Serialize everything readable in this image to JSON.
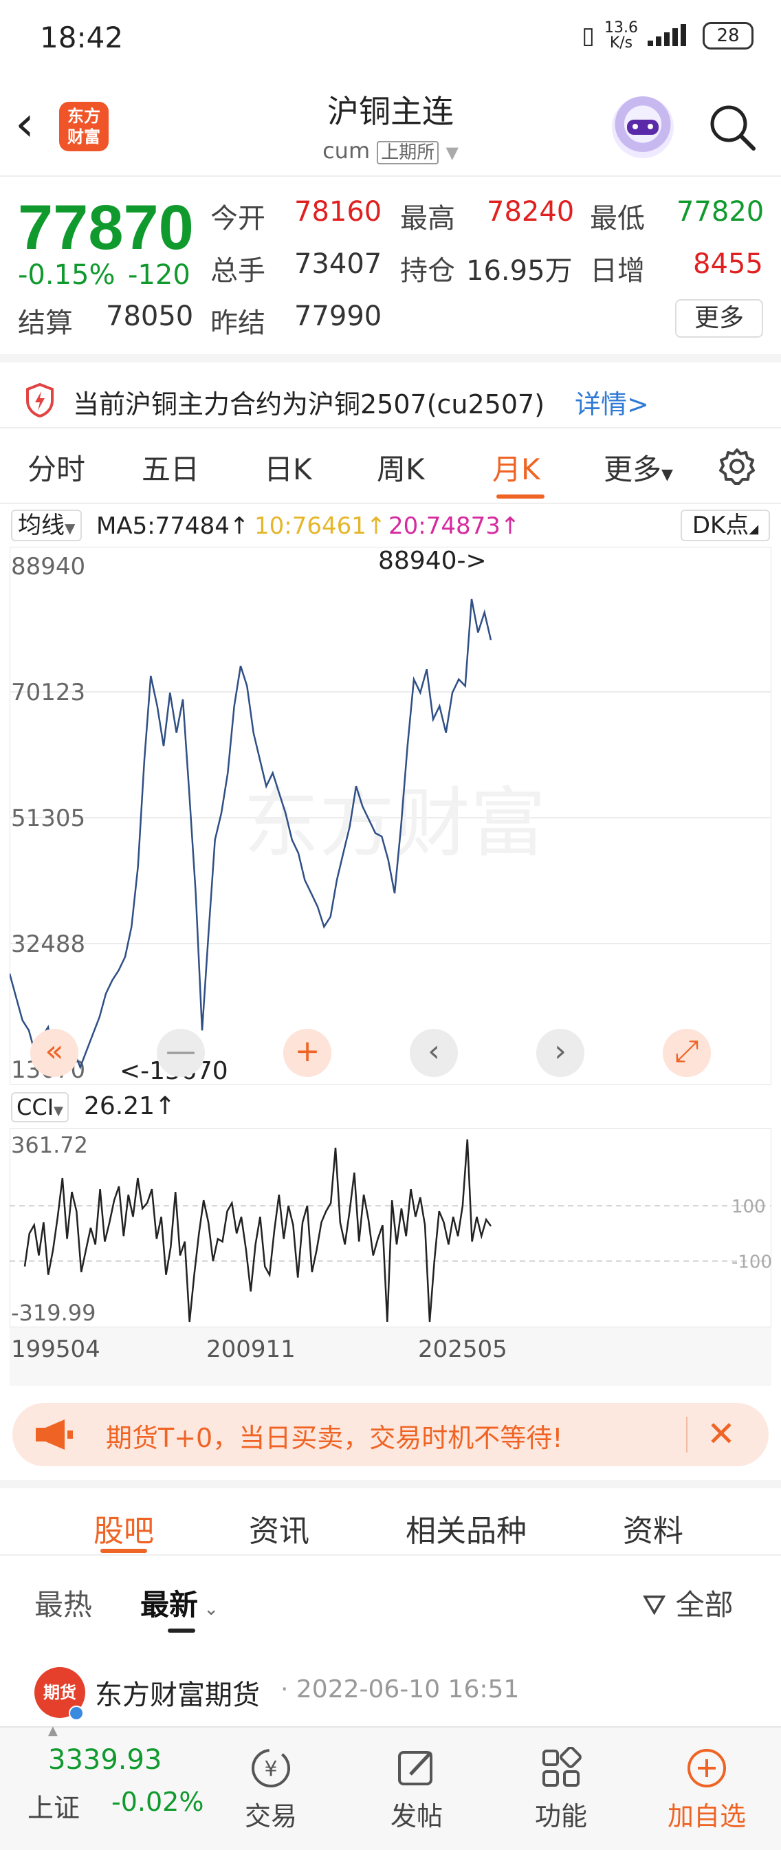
{
  "status_bar": {
    "time": "18:42",
    "net_speed_top": "13.6",
    "net_speed_bottom": "K/s",
    "battery": "28"
  },
  "header": {
    "title": "沪铜主连",
    "code": "cum",
    "exchange": "上期所",
    "logo_line1": "东方",
    "logo_line2": "财富"
  },
  "quote": {
    "last": "77870",
    "pct": "-0.15%",
    "chg": "-120",
    "open_label": "今开",
    "open": "78160",
    "high_label": "最高",
    "high": "78240",
    "low_label": "最低",
    "low": "77820",
    "volume_label": "总手",
    "volume": "73407",
    "oi_label": "持仓",
    "oi": "16.95万",
    "daily_inc_label": "日增",
    "daily_inc": "8455",
    "settle_label": "结算",
    "settle": "78050",
    "prev_settle_label": "昨结",
    "prev_settle": "77990",
    "more": "更多"
  },
  "notice": {
    "text": "当前沪铜主力合约为沪铜2507(cu2507)",
    "link": "详情>"
  },
  "period_tabs": [
    "分时",
    "五日",
    "日K",
    "周K",
    "月K",
    "更多"
  ],
  "active_period": "月K",
  "ma": {
    "select": "均线",
    "ma5": "MA5:77484↑",
    "ma10": "10:76461↑",
    "ma20": "20:74873↑",
    "dk": "DK点"
  },
  "chart_data": [
    {
      "type": "line",
      "title": "",
      "y_ticks": [
        "88940",
        "70123",
        "51305",
        "32488",
        "13670"
      ],
      "ylim": [
        13670,
        88940
      ],
      "max_label": "88940->",
      "min_label": "<-13670",
      "series": [
        {
          "values": [
            28000,
            24500,
            21000,
            19500,
            16000,
            18500,
            20000,
            15000,
            17000,
            14500,
            16500,
            14000,
            16500,
            19000,
            21500,
            25000,
            27000,
            28500,
            30500,
            35000,
            44000,
            60000,
            72500,
            68000,
            62000,
            70000,
            64000,
            69000,
            55000,
            40000,
            19500,
            34000,
            48000,
            52000,
            58000,
            68000,
            74000,
            71000,
            64000,
            60000,
            56000,
            58000,
            55000,
            52000,
            48000,
            46000,
            42000,
            40000,
            38000,
            35000,
            36500,
            42000,
            46000,
            50000,
            56000,
            53000,
            51000,
            49000,
            48500,
            45000,
            40000,
            50000,
            62000,
            72000,
            70000,
            73500,
            66000,
            68000,
            64000,
            70000,
            72000,
            71000,
            84000,
            79000,
            82000,
            77870
          ]
        }
      ]
    },
    {
      "type": "line",
      "title": "",
      "y_ticks": [
        "361.72",
        "-319.99"
      ],
      "ref_lines": [
        "100",
        "-100"
      ],
      "indicator": "CCI",
      "value": "26.21↑",
      "x_ticks": [
        "199504",
        "200911",
        "202505"
      ],
      "series": [
        {
          "values": [
            -120,
            0,
            30,
            -80,
            40,
            -150,
            -60,
            60,
            200,
            -20,
            150,
            80,
            -140,
            -60,
            20,
            -40,
            160,
            -30,
            40,
            120,
            170,
            -10,
            140,
            60,
            200,
            90,
            110,
            160,
            -20,
            60,
            -150,
            -50,
            150,
            -80,
            -30,
            -320,
            -150,
            0,
            120,
            40,
            -100,
            -20,
            -30,
            80,
            110,
            0,
            60,
            -60,
            -210,
            -40,
            60,
            -120,
            -150,
            10,
            140,
            -20,
            100,
            30,
            -160,
            40,
            100,
            -140,
            -60,
            40,
            80,
            110,
            310,
            40,
            -40,
            80,
            220,
            -30,
            140,
            50,
            -80,
            -20,
            30,
            -320,
            120,
            -40,
            90,
            -10,
            160,
            60,
            130,
            30,
            -320,
            -100,
            80,
            40,
            -40,
            60,
            -10,
            100,
            340,
            -30,
            60,
            -10,
            50,
            26
          ]
        }
      ]
    }
  ],
  "chart_controls": [
    "«",
    "—",
    "+",
    "‹",
    "›",
    "⤢"
  ],
  "promo": {
    "text": "期货T+0，当日买卖，交易时机不等待!"
  },
  "sub_tabs": [
    "股吧",
    "资讯",
    "相关品种",
    "资料"
  ],
  "filters": {
    "hot": "最热",
    "latest": "最新",
    "all": "全部"
  },
  "post": {
    "author": "东方财富期货",
    "time": "· 2022-06-10 16:51",
    "avatar": "期货"
  },
  "bottom_nav": {
    "index_value": "3339.93",
    "index_name": "上证",
    "index_pct": "-0.02%",
    "trade": "交易",
    "post": "发帖",
    "function": "功能",
    "add": "加自选"
  },
  "colors": {
    "up": "#e02020",
    "down": "#109a2e",
    "accent": "#ef6424",
    "line": "#2f4f85",
    "link": "#2f7ad6"
  }
}
